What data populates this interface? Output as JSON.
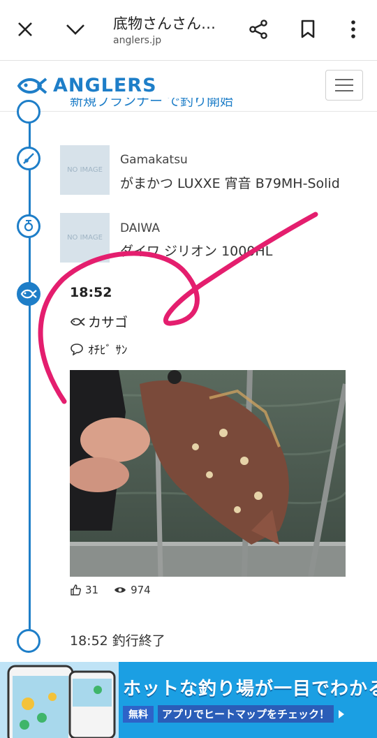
{
  "browser": {
    "title": "底物さんさん…",
    "domain": "anglers.jp"
  },
  "site": {
    "logo_text": "ANGLERS",
    "brand_color": "#1e7ec8"
  },
  "timeline": {
    "partial_text": "新規プランナー で釣り開始",
    "tackle": [
      {
        "brand": "Gamakatsu",
        "name": "がまかつ LUXXE 宵音 B79MH-Solid",
        "image_label": "NO IMAGE",
        "icon": "rod-icon"
      },
      {
        "brand": "DAIWA",
        "name": "ダイワ ジリオン 1000HL",
        "image_label": "NO IMAGE",
        "icon": "reel-icon"
      }
    ],
    "catch": {
      "time": "18:52",
      "species": "カサゴ",
      "comment": "ｵﾁﾋﾞ ｻﾝ",
      "likes": "31",
      "views": "974"
    },
    "end": "18:52 釣行終了"
  },
  "banner": {
    "headline": "ホットな釣り場が一目でわかる",
    "badge": "無料",
    "sub": "アプリでヒートマップをチェック！"
  }
}
